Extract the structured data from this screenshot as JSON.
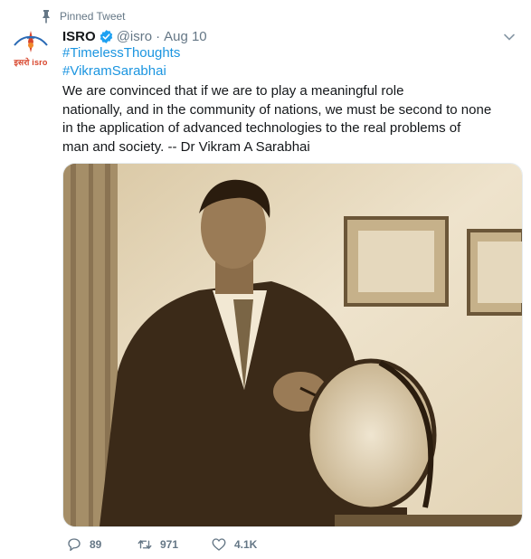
{
  "pinned": {
    "label": "Pinned Tweet",
    "icon": "pin-icon"
  },
  "author": {
    "avatar_text": "इसरो isro",
    "name": "ISRO",
    "handle": "@isro",
    "separator": "·",
    "date": "Aug 10"
  },
  "tweet": {
    "hashtags": [
      "#TimelessThoughts",
      "#VikramSarabhai"
    ],
    "lines": [
      "We are convinced that if we are to play a meaningful role",
      "nationally, and in the community of nations, we must be second to none",
      "in the application of advanced technologies to the real problems of",
      "man and society. -- Dr Vikram A Sarabhai"
    ]
  },
  "actions": {
    "reply_count": "89",
    "retweet_count": "971",
    "like_count": "4.1K"
  },
  "colors": {
    "link": "#1b95e0",
    "secondary": "#657786",
    "verified": "#1da1f2",
    "sepia_light": "#e9dcc0",
    "sepia_dark": "#3b2a18"
  }
}
